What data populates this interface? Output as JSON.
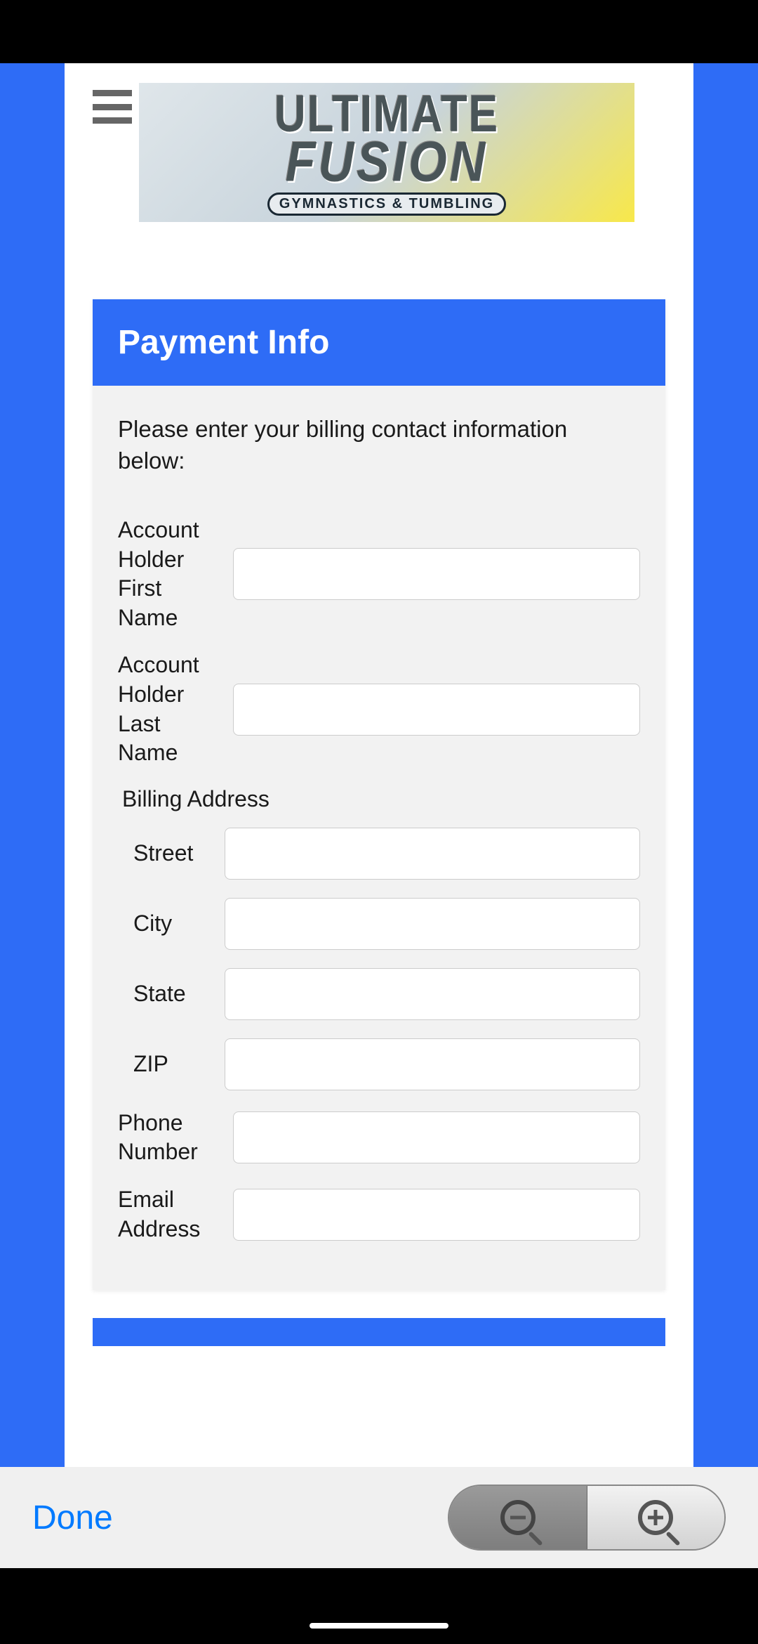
{
  "logo": {
    "line1": "ULTIMATE",
    "line2": "FUSION",
    "tagline": "GYMNASTICS & TUMBLING"
  },
  "card": {
    "title": "Payment Info",
    "instruction": "Please enter your billing contact information below:"
  },
  "form": {
    "first_name": {
      "label": "Account Holder First Name",
      "value": ""
    },
    "last_name": {
      "label": "Account Holder Last Name",
      "value": ""
    },
    "billing_section": "Billing Address",
    "street": {
      "label": "Street",
      "value": ""
    },
    "city": {
      "label": "City",
      "value": ""
    },
    "state": {
      "label": "State",
      "value": ""
    },
    "zip": {
      "label": "ZIP",
      "value": ""
    },
    "phone": {
      "label": "Phone Number",
      "value": ""
    },
    "email": {
      "label": "Email Address",
      "value": ""
    }
  },
  "toolbar": {
    "done_label": "Done"
  }
}
